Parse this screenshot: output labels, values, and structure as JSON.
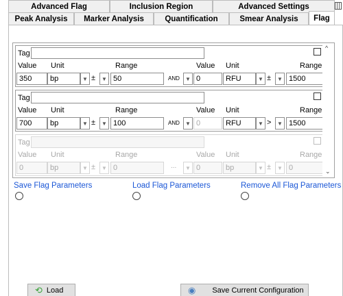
{
  "tabs_row1": [
    {
      "label": "Advanced Flag"
    },
    {
      "label": "Inclusion Region"
    },
    {
      "label": "Advanced Settings"
    }
  ],
  "tabs_row2": [
    {
      "label": "Peak Analysis"
    },
    {
      "label": "Marker Analysis"
    },
    {
      "label": "Quantification"
    },
    {
      "label": "Smear Analysis"
    },
    {
      "label": "Flag",
      "active": true
    }
  ],
  "labels": {
    "tag": "Tag",
    "value": "Value",
    "unit": "Unit",
    "range": "Range",
    "value_right": "Value",
    "unit_right": "Unit",
    "range_right": "Range"
  },
  "flag_groups": [
    {
      "enabled": true,
      "checked": false,
      "tag": "",
      "left": {
        "value": "350",
        "unit": "bp",
        "sign": "±",
        "range": "50"
      },
      "operator": "AND",
      "right": {
        "value": "0",
        "unit": "RFU",
        "sign": "±",
        "range": "1500"
      }
    },
    {
      "enabled": true,
      "checked": false,
      "tag": "",
      "left": {
        "value": "700",
        "unit": "bp",
        "sign": "±",
        "range": "100"
      },
      "operator": "AND",
      "right": {
        "value": "0",
        "unit": "RFU",
        "sign": ">",
        "range": "1500"
      }
    },
    {
      "enabled": false,
      "checked": false,
      "tag": "",
      "left": {
        "value": "0",
        "unit": "bp",
        "sign": "±",
        "range": "0"
      },
      "operator": "...",
      "right": {
        "value": "0",
        "unit": "bp",
        "sign": "±",
        "range": "0"
      }
    }
  ],
  "actions": {
    "save_flag": "Save Flag Parameters",
    "load_flag": "Load Flag Parameters",
    "remove_all": "Remove All Flag Parameters"
  },
  "buttons": {
    "load": "Load",
    "save_config": "Save Current Configuration"
  },
  "colors": {
    "link": "#1a56d6",
    "tab_bg": "#f0f0f0",
    "button_bg": "#e1e1e1"
  }
}
